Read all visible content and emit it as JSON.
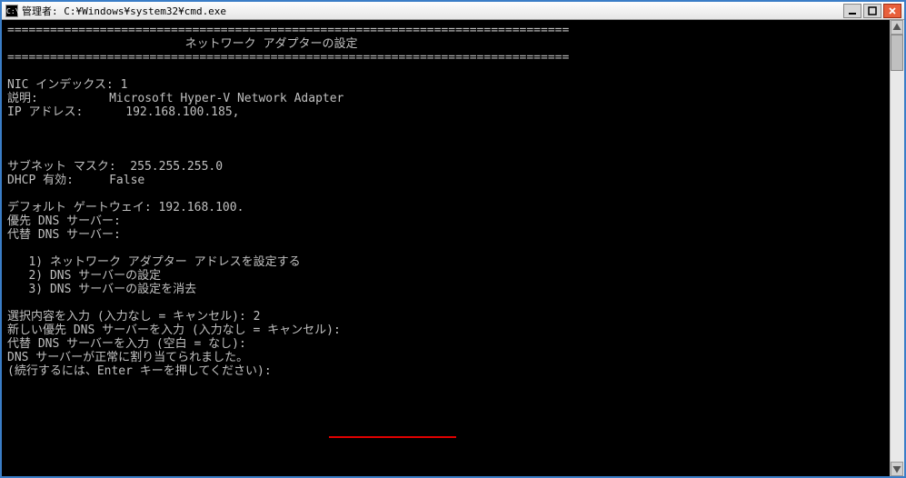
{
  "titlebar": {
    "icon_label": "C:\\",
    "title": "管理者: C:¥Windows¥system32¥cmd.exe"
  },
  "terminal": {
    "divider_top": "===============================================================================",
    "header": "                         ネットワーク アダプターの設定",
    "divider_bot": "===============================================================================",
    "nic_index": "NIC インデックス: 1",
    "description": "説明:          Microsoft Hyper-V Network Adapter",
    "ip_address": "IP アドレス:      192.168.100.185,",
    "subnet": "サブネット マスク:  255.255.255.0",
    "dhcp": "DHCP 有効:     False",
    "gateway": "デフォルト ゲートウェイ: 192.168.100.",
    "dns_primary": "優先 DNS サーバー:",
    "dns_alt": "代替 DNS サーバー:",
    "opt1": "   1) ネットワーク アダプター アドレスを設定する",
    "opt2": "   2) DNS サーバーの設定",
    "opt3": "   3) DNS サーバーの設定を消去",
    "prompt_select": "選択内容を入力 (入力なし = キャンセル): 2",
    "prompt_new_pri": "新しい優先 DNS サーバーを入力 (入力なし = キャンセル):",
    "prompt_alt": "代替 DNS サーバーを入力 (空白 = なし):",
    "assigned_ok": "DNS サーバーが正常に割り当てられました。",
    "continue": "(続行するには、Enter キーを押してください):"
  }
}
